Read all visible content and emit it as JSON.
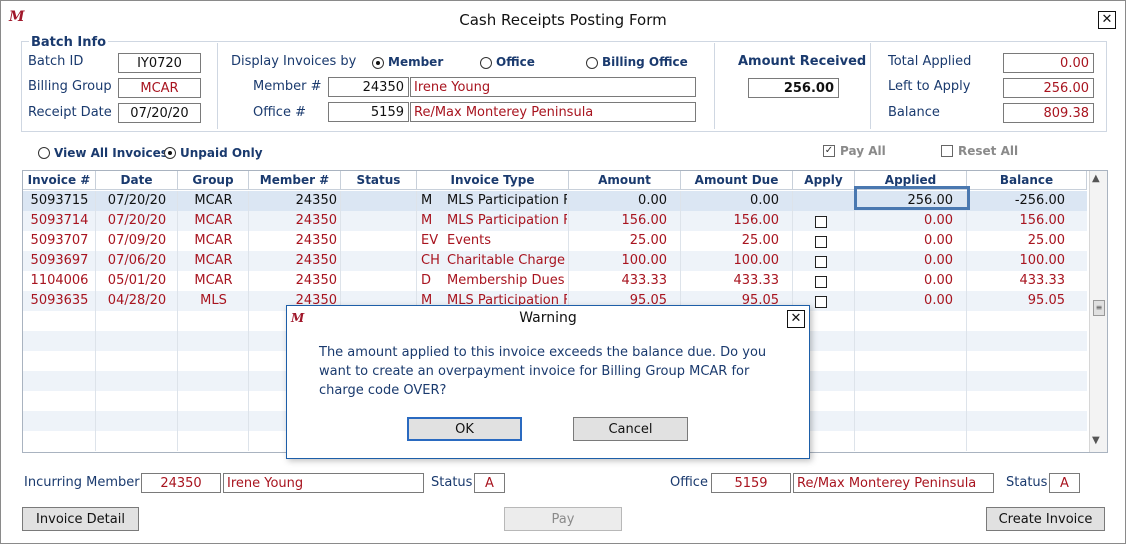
{
  "window": {
    "title": "Cash Receipts Posting Form",
    "logo": "M",
    "close_symbol": "✕"
  },
  "batch": {
    "heading": "Batch Info",
    "batch_id_label": "Batch ID",
    "batch_id": "IY0720",
    "billing_group_label": "Billing Group",
    "billing_group": "MCAR",
    "receipt_date_label": "Receipt Date",
    "receipt_date": "07/20/20"
  },
  "display": {
    "label": "Display Invoices by",
    "options": [
      "Member",
      "Office",
      "Billing Office"
    ],
    "selected": "Member",
    "member_label": "Member #",
    "member_no": "24350",
    "member_name": "Irene Young",
    "office_label": "Office #",
    "office_no": "5159",
    "office_name": "Re/Max Monterey Peninsula"
  },
  "amount": {
    "label": "Amount Received",
    "value": "256.00"
  },
  "totals": {
    "total_applied_label": "Total Applied",
    "total_applied": "0.00",
    "left_label": "Left to Apply",
    "left": "256.00",
    "balance_label": "Balance",
    "balance": "809.38"
  },
  "filters": {
    "view_all": "View All Invoices",
    "unpaid_only": "Unpaid Only",
    "pay_all": "Pay All",
    "reset_all": "Reset All"
  },
  "grid": {
    "columns": [
      "Invoice #",
      "Date",
      "Group",
      "Member #",
      "Status",
      "Invoice Type",
      "Amount",
      "Amount Due",
      "Apply",
      "Applied",
      "Balance"
    ],
    "rows": [
      {
        "invoice": "5093715",
        "date": "07/20/20",
        "group": "MCAR",
        "member": "24350",
        "status": "",
        "type_code": "M",
        "type": "MLS Participation F",
        "amount": "0.00",
        "due": "0.00",
        "apply": "",
        "applied": "256.00",
        "balance": "-256.00"
      },
      {
        "invoice": "5093714",
        "date": "07/20/20",
        "group": "MCAR",
        "member": "24350",
        "status": "",
        "type_code": "M",
        "type": "MLS Participation F",
        "amount": "156.00",
        "due": "156.00",
        "apply": "☐",
        "applied": "0.00",
        "balance": "156.00"
      },
      {
        "invoice": "5093707",
        "date": "07/09/20",
        "group": "MCAR",
        "member": "24350",
        "status": "",
        "type_code": "EV",
        "type": "Events",
        "amount": "25.00",
        "due": "25.00",
        "apply": "☐",
        "applied": "0.00",
        "balance": "25.00"
      },
      {
        "invoice": "5093697",
        "date": "07/06/20",
        "group": "MCAR",
        "member": "24350",
        "status": "",
        "type_code": "CH",
        "type": "Charitable Charge",
        "amount": "100.00",
        "due": "100.00",
        "apply": "☐",
        "applied": "0.00",
        "balance": "100.00"
      },
      {
        "invoice": "1104006",
        "date": "05/01/20",
        "group": "MCAR",
        "member": "24350",
        "status": "",
        "type_code": "D",
        "type": "Membership Dues",
        "amount": "433.33",
        "due": "433.33",
        "apply": "☐",
        "applied": "0.00",
        "balance": "433.33"
      },
      {
        "invoice": "5093635",
        "date": "04/28/20",
        "group": "MLS",
        "member": "24350",
        "status": "",
        "type_code": "M",
        "type": "MLS Participation F",
        "amount": "95.05",
        "due": "95.05",
        "apply": "☐",
        "applied": "0.00",
        "balance": "95.05"
      }
    ]
  },
  "footer": {
    "incurring_label": "Incurring Member",
    "incurring_no": "24350",
    "incurring_name": "Irene Young",
    "status_label": "Status",
    "status": "A",
    "office_label": "Office",
    "office_no": "5159",
    "office_name": "Re/Max Monterey Peninsula",
    "office_status_label": "Status",
    "office_status": "A"
  },
  "buttons": {
    "invoice_detail": "Invoice Detail",
    "pay": "Pay",
    "create_invoice": "Create Invoice"
  },
  "dialog": {
    "title": "Warning",
    "message": "The amount applied to this invoice exceeds the balance due.  Do you want to create an overpayment invoice for Billing Group MCAR for charge code OVER?",
    "ok": "OK",
    "cancel": "Cancel"
  },
  "colors": {
    "accent_red": "#a8141f",
    "label_blue": "#1a3a6e",
    "selected_row": "#dbe6f3",
    "focus_border": "#4a78b0"
  }
}
